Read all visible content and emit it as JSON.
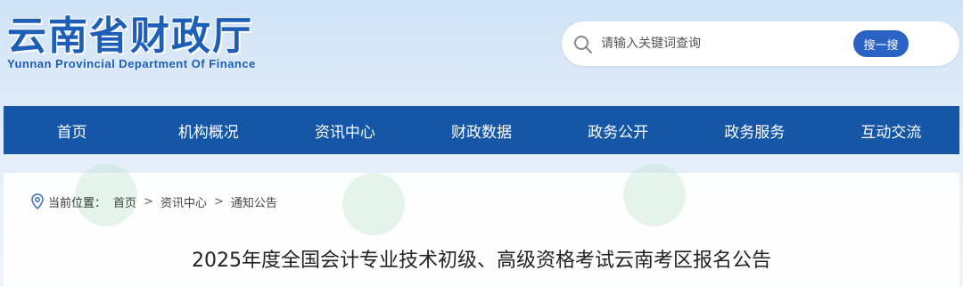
{
  "header": {
    "site_name_cn": "云南省财政厅",
    "site_name_en": "Yunnan Provincial Department Of Finance"
  },
  "search": {
    "placeholder": "请输入关键词查询",
    "button_label": "搜一搜"
  },
  "nav": {
    "items": [
      {
        "label": "首页"
      },
      {
        "label": "机构概况"
      },
      {
        "label": "资讯中心"
      },
      {
        "label": "财政数据"
      },
      {
        "label": "政务公开"
      },
      {
        "label": "政务服务"
      },
      {
        "label": "互动交流"
      }
    ]
  },
  "breadcrumb": {
    "label": "当前位置：",
    "items": [
      "首页",
      "资讯中心",
      "通知公告"
    ],
    "separator": ">"
  },
  "article": {
    "title": "2025年度全国会计专业技术初级、高级资格考试云南考区报名公告"
  },
  "colors": {
    "brand_blue": "#1d5fb8",
    "nav_blue": "#1556a7",
    "button_blue": "#2a63c4"
  }
}
